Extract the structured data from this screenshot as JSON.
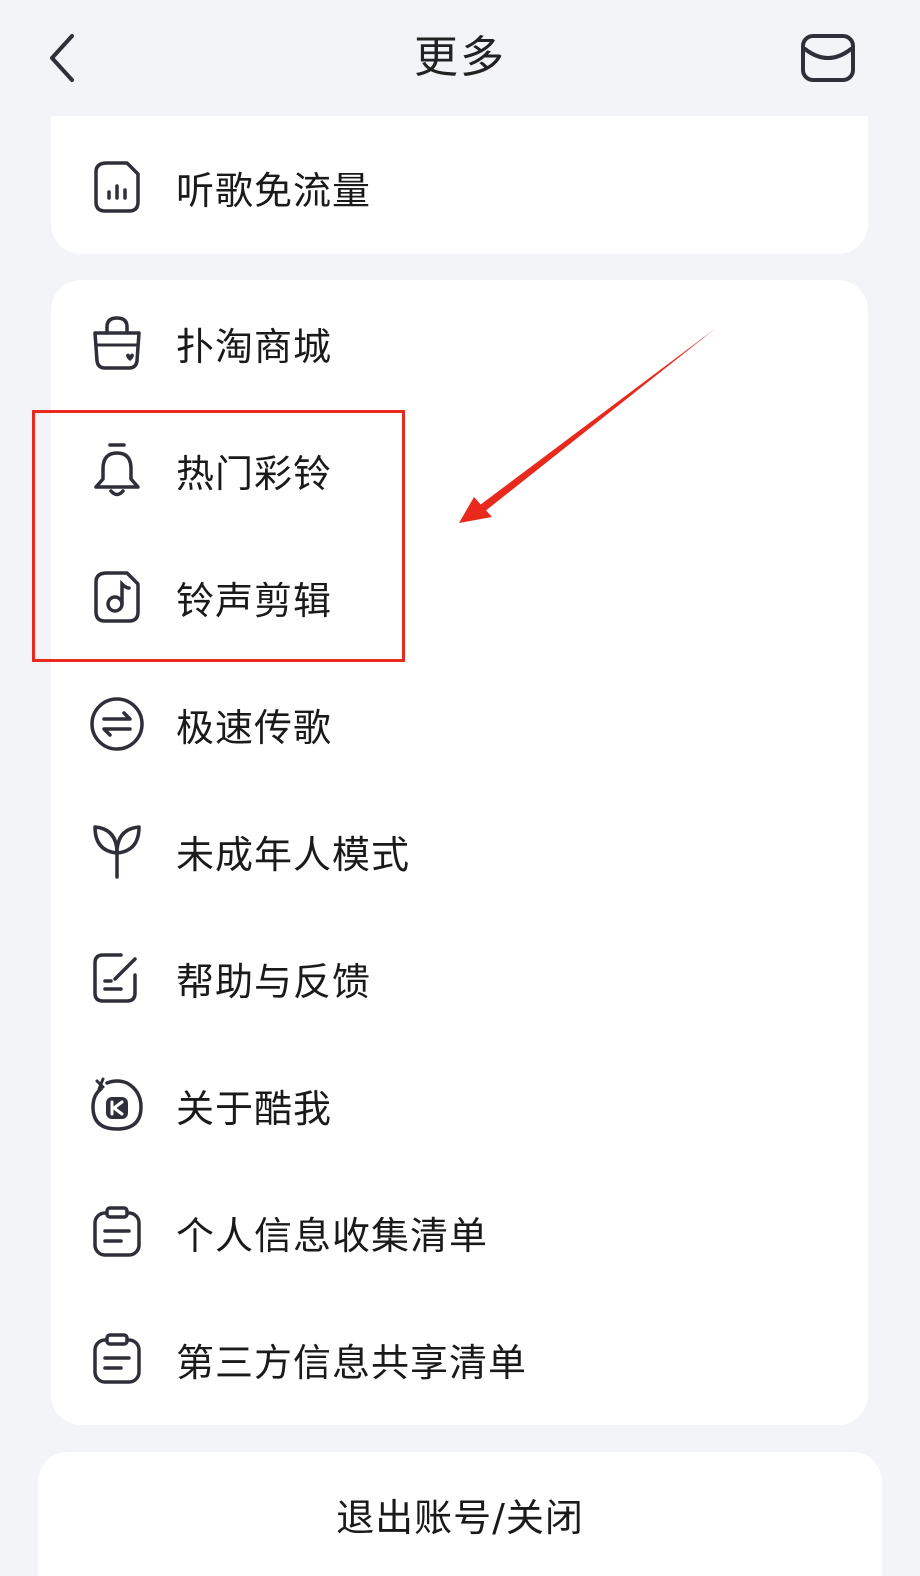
{
  "header": {
    "title": "更多",
    "back_icon": "chevron-left-icon",
    "message_icon": "mailbox-icon"
  },
  "top_card": {
    "items": [
      {
        "label": "听歌免流量",
        "icon": "data-bars-icon"
      }
    ]
  },
  "main_card": {
    "items": [
      {
        "label": "扑淘商城",
        "icon": "shopping-bag-icon"
      },
      {
        "label": "热门彩铃",
        "icon": "bell-icon"
      },
      {
        "label": "铃声剪辑",
        "icon": "music-note-icon"
      },
      {
        "label": "极速传歌",
        "icon": "transfer-arrows-icon"
      },
      {
        "label": "未成年人模式",
        "icon": "sprout-icon"
      },
      {
        "label": "帮助与反馈",
        "icon": "edit-note-icon"
      },
      {
        "label": "关于酷我",
        "icon": "kuwo-logo-icon"
      },
      {
        "label": "个人信息收集清单",
        "icon": "clipboard-list-icon"
      },
      {
        "label": "第三方信息共享清单",
        "icon": "clipboard-list-icon"
      }
    ]
  },
  "logout": {
    "label": "退出账号/关闭"
  },
  "colors": {
    "background": "#f3f4f8",
    "card": "#ffffff",
    "icon_stroke": "#2f2f3a",
    "annotation": "#e8291c"
  }
}
